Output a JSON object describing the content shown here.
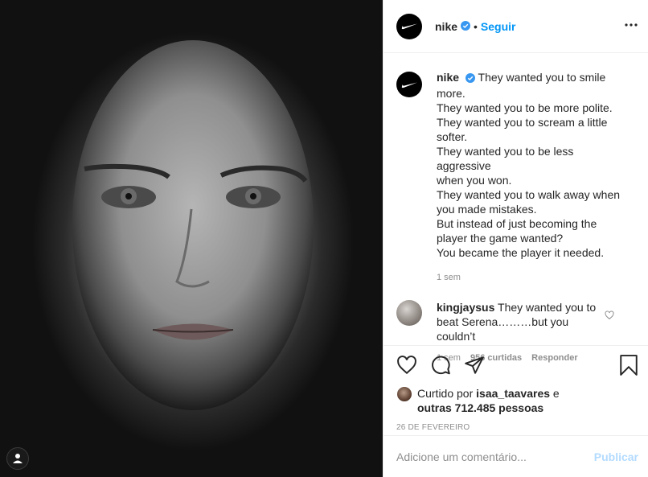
{
  "post": {
    "username": "nike",
    "follow_label": "Seguir",
    "dot": "•",
    "caption_lines": [
      "They wanted you to smile",
      "more.",
      "They wanted you to be more polite.",
      "They wanted you to scream a little",
      "softer.",
      "They wanted you to be less aggressive",
      "when you won.",
      "They wanted you to walk away when",
      "you made mistakes.",
      "But instead of just becoming the",
      "player the game wanted?",
      "You became the player it needed."
    ],
    "caption_age": "1 sem",
    "date": "26 DE FEVEREIRO"
  },
  "comment": {
    "username": "kingjaysus",
    "text_line1": "They wanted you to",
    "text_line2": "beat Serena………but you couldn’t",
    "age": "1 sem",
    "likes": "956 curtidas",
    "reply_label": "Responder"
  },
  "likes": {
    "prefix": "Curtido por",
    "user": "isaa_taavares",
    "joiner": "e",
    "others": "outras 712.485 pessoas"
  },
  "add_comment": {
    "placeholder": "Adicione um comentário...",
    "publish_label": "Publicar"
  },
  "colors": {
    "accent": "#0095f6",
    "publish_disabled": "#b3dbff",
    "muted": "#8e8e8e"
  },
  "icons": [
    "nike-swoosh-icon",
    "verified-icon",
    "more-icon",
    "heart-icon",
    "comment-icon",
    "share-icon",
    "bookmark-icon",
    "user-tag-icon"
  ]
}
